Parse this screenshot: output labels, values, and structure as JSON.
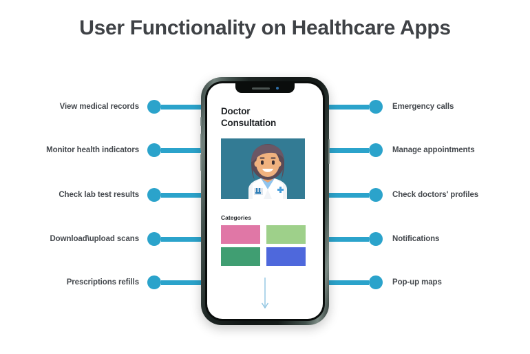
{
  "page": {
    "title": "User Functionality on Healthcare Apps",
    "background_color": "#ffffff",
    "accent_color": "#2ba3cb",
    "title_color": "#3f4246"
  },
  "features": {
    "left": [
      {
        "label": "View medical records",
        "connector_icon": "dot-line-connector-icon"
      },
      {
        "label": "Monitor health indicators",
        "connector_icon": "dot-line-connector-icon"
      },
      {
        "label": "Check lab test results",
        "connector_icon": "dot-line-connector-icon"
      },
      {
        "label": "Download\\upload scans",
        "connector_icon": "dot-line-connector-icon"
      },
      {
        "label": "Prescriptions refills",
        "connector_icon": "dot-line-connector-icon"
      }
    ],
    "right": [
      {
        "label": "Emergency calls",
        "connector_icon": "dot-line-connector-icon"
      },
      {
        "label": "Manage appointments",
        "connector_icon": "dot-line-connector-icon"
      },
      {
        "label": "Check doctors' profiles",
        "connector_icon": "dot-line-connector-icon"
      },
      {
        "label": "Notifications",
        "connector_icon": "dot-line-connector-icon"
      },
      {
        "label": "Pop-up maps",
        "connector_icon": "dot-line-connector-icon"
      }
    ]
  },
  "phone": {
    "frame_color": "#1d2523",
    "screen_background": "#ffffff",
    "notch": {
      "speaker_icon": "speaker-grille-icon",
      "camera_icon": "front-camera-icon"
    },
    "app": {
      "title": "Doctor\nConsultation",
      "hero": {
        "illustration_icon": "female-doctor-illustration",
        "background_color": "#337b94",
        "coat_color": "#ffffff",
        "hair_color": "#5b4a55",
        "skin_color": "#f0b27f",
        "shirt_color": "#8fc4ee",
        "badge_icon": "medical-cross-icon"
      },
      "categories_label": "Categories",
      "category_tiles": [
        {
          "name": "category-tile-pink",
          "color": "#e077a6"
        },
        {
          "name": "category-tile-light-green",
          "color": "#9ed08a"
        },
        {
          "name": "category-tile-green",
          "color": "#409e72"
        },
        {
          "name": "category-tile-blue",
          "color": "#4e68dc"
        }
      ],
      "scroll_arrow_icon": "scroll-down-arrow-icon",
      "scroll_arrow_color": "#8ec4e0"
    }
  }
}
